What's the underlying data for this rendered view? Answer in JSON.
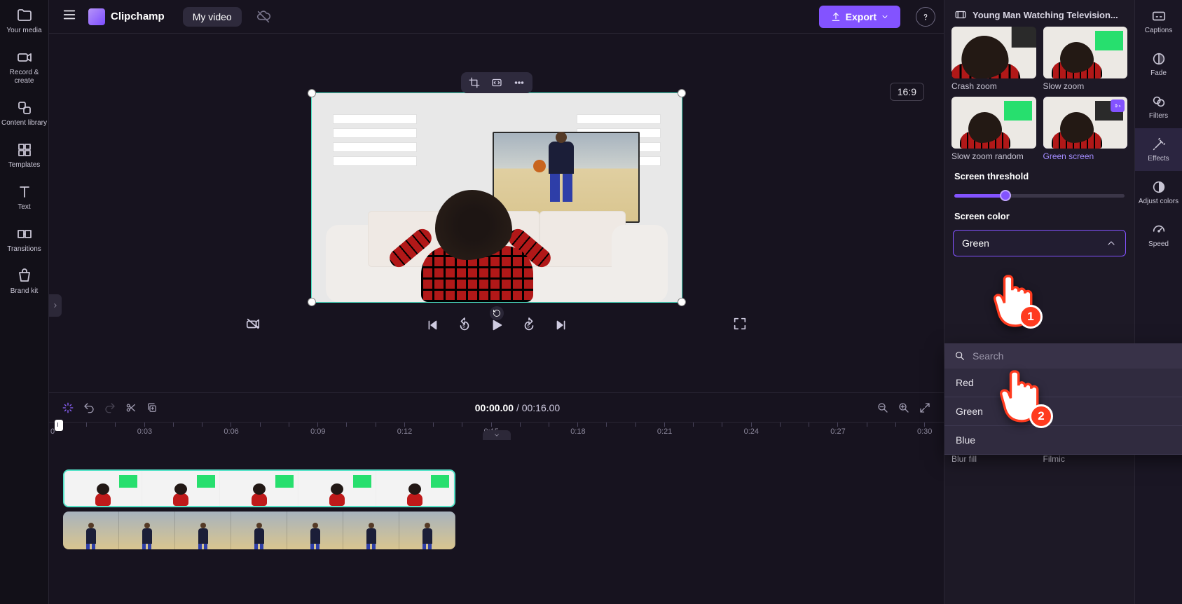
{
  "app": {
    "name": "Clipchamp",
    "project": "My video",
    "export_label": "Export"
  },
  "left_nav": {
    "media": "Your media",
    "record": "Record & create",
    "library": "Content library",
    "templates": "Templates",
    "text": "Text",
    "transitions": "Transitions",
    "brand": "Brand kit"
  },
  "preview": {
    "aspect": "16:9"
  },
  "playback": {
    "current": "00:00.00",
    "separator": "/",
    "total": "00:16.00"
  },
  "ruler": [
    "0",
    "0:03",
    "0:06",
    "0:09",
    "0:12",
    "0:15",
    "0:18",
    "0:21",
    "0:24",
    "0:27",
    "0:30"
  ],
  "effects": {
    "clip_title": "Young Man Watching Television...",
    "items": {
      "crash_zoom": "Crash zoom",
      "slow_zoom": "Slow zoom",
      "slow_zoom_random": "Slow zoom random",
      "green_screen": "Green screen",
      "blur_fill": "Blur fill",
      "filmic": "Filmic"
    },
    "threshold_label": "Screen threshold",
    "threshold_pct": 30,
    "color_label": "Screen color",
    "color_selected": "Green",
    "search_placeholder": "Search",
    "options": {
      "red": "Red",
      "green": "Green",
      "blue": "Blue"
    }
  },
  "right_rail": {
    "captions": "Captions",
    "fade": "Fade",
    "filters": "Filters",
    "effects": "Effects",
    "adjust": "Adjust colors",
    "speed": "Speed"
  },
  "annotations": {
    "b1": "1",
    "b2": "2"
  }
}
